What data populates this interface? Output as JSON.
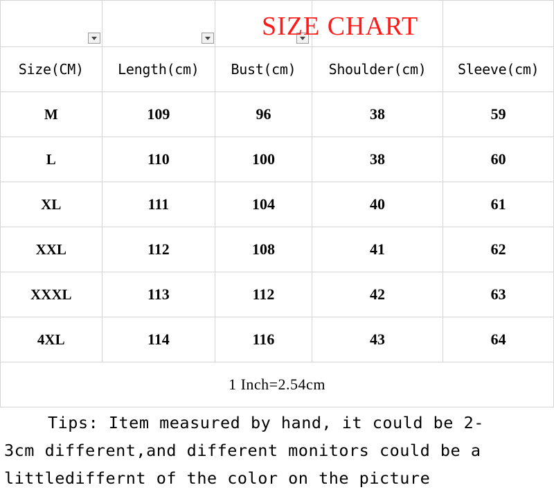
{
  "title": "SIZE CHART",
  "headers": [
    "Size(CM)",
    "Length(cm)",
    "Bust(cm)",
    "Shoulder(cm)",
    "Sleeve(cm)"
  ],
  "rows": [
    [
      "M",
      "109",
      "96",
      "38",
      "59"
    ],
    [
      "L",
      "110",
      "100",
      "38",
      "60"
    ],
    [
      "XL",
      "111",
      "104",
      "40",
      "61"
    ],
    [
      "XXL",
      "112",
      "108",
      "41",
      "62"
    ],
    [
      "XXXL",
      "113",
      "112",
      "42",
      "63"
    ],
    [
      "4XL",
      "114",
      "116",
      "43",
      "64"
    ]
  ],
  "conversion": "1 Inch=2.54cm",
  "tips": {
    "line1": "Tips: Item measured by hand, it could be 2-",
    "line2": "3cm different,and different monitors could be a",
    "line3": "littlediffernt of the color on the picture"
  },
  "colors": {
    "title": "#ff1a1a",
    "gridline": "#d4d4d4"
  }
}
